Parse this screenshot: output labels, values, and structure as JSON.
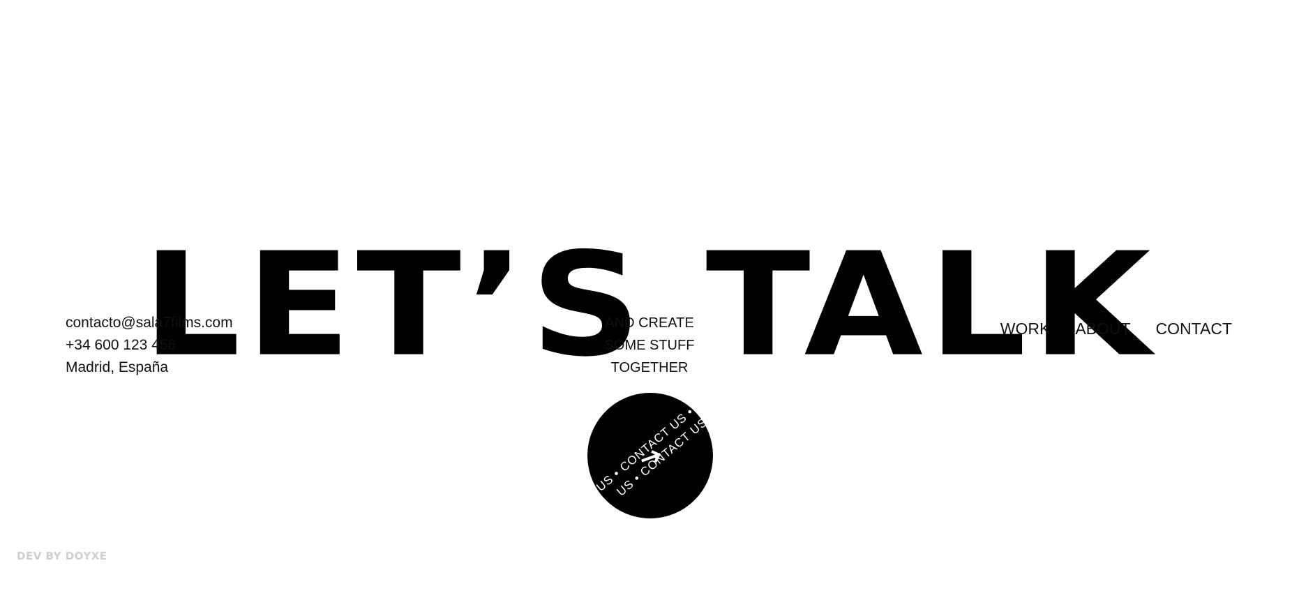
{
  "hero": {
    "title": "LET’S TALK"
  },
  "contact_info": {
    "email": "contacto@sala7films.com",
    "phone": "+34 600 123 456",
    "location": "Madrid, España"
  },
  "tagline": {
    "line1": "AND CREATE",
    "line2": "SOME STUFF",
    "line3": "TOGETHER"
  },
  "nav": {
    "work": "WORK",
    "about": "ABOUT",
    "contact": "CONTACT"
  },
  "contact_button": {
    "ring_text_1": "US • CONTACT US •",
    "ring_text_2": "US • CONTACT US •",
    "icon": "arrow-right-icon",
    "background": "#000000",
    "text_color": "#ffffff"
  },
  "footer": {
    "credit": "DEV BY DOYXE"
  }
}
